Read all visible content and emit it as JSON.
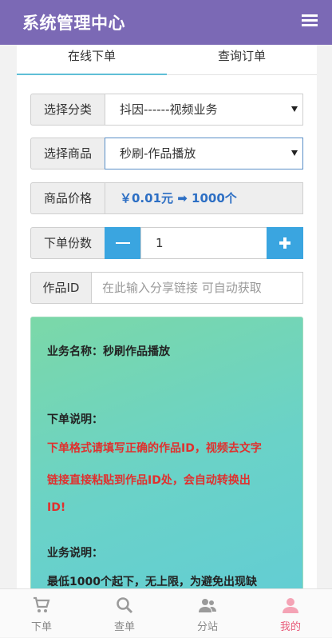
{
  "header": {
    "title": "系统管理中心",
    "menu_icon": "hamburger-menu-icon"
  },
  "tabs": [
    {
      "label": "在线下单",
      "active": true
    },
    {
      "label": "查询订单",
      "active": false
    }
  ],
  "form": {
    "category": {
      "label": "选择分类",
      "value": "抖因------视频业务"
    },
    "product": {
      "label": "选择商品",
      "value": "秒刷-作品播放"
    },
    "price": {
      "label": "商品价格",
      "value": "￥0.01元 ➡ 1000个"
    },
    "quantity": {
      "label": "下单份数",
      "value": "1"
    },
    "work_id": {
      "label": "作品ID",
      "placeholder": "在此输入分享链接 可自动获取"
    }
  },
  "info": {
    "business_name": "业务名称：秒刷作品播放",
    "order_title": "下单说明：",
    "order_line1": "下单格式请填写正确的作品ID，视频去文字",
    "order_line2": "链接直接粘贴到作品ID处，会自动转换出",
    "order_line3": "ID!",
    "desc_title": "业务说明：",
    "desc_line1": "最低1000个起下，无上限，为避免出现缺"
  },
  "bottom_nav": [
    {
      "label": "下单",
      "icon": "cart-icon"
    },
    {
      "label": "查单",
      "icon": "search-icon"
    },
    {
      "label": "分站",
      "icon": "users-icon"
    },
    {
      "label": "我的",
      "icon": "user-icon"
    }
  ],
  "colors": {
    "header": "#7b69b5",
    "accent": "#3aa5e0",
    "price": "#2d6fc4",
    "warning": "#e0302e",
    "mine": "#e85c7a"
  }
}
